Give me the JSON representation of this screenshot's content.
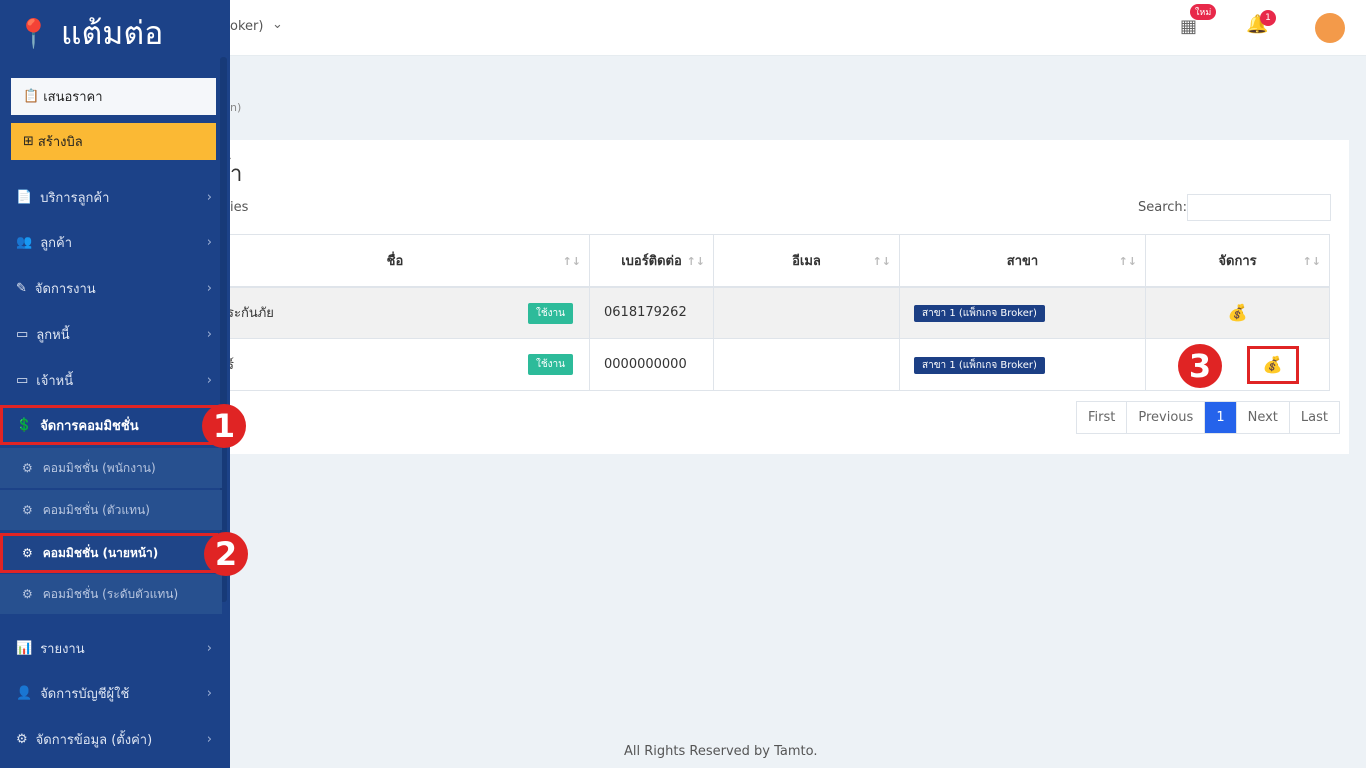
{
  "header": {
    "branch_fragment": "oker)",
    "badge_new": "ใหม่",
    "notif_count": "1"
  },
  "breadcrumb_fragment": "n)",
  "main": {
    "title_fragment": "้า",
    "show_entries_fragment": "ies",
    "info_fragment": "es",
    "search_label": "Search:",
    "search_value": "",
    "columns": [
      "ชื่อ",
      "เบอร์ติดต่อ",
      "อีเมล",
      "สาขา",
      "จัดการ"
    ],
    "rows": [
      {
        "name": "ระกันภัย",
        "status": "ใช้งาน",
        "phone": "0618179262",
        "email": "",
        "branch": "สาขา 1 (แพ็กเกจ Broker)"
      },
      {
        "name": "ร์",
        "status": "ใช้งาน",
        "phone": "0000000000",
        "email": "",
        "branch": "สาขา 1 (แพ็กเกจ Broker)"
      }
    ],
    "pagination": [
      "First",
      "Previous",
      "1",
      "Next",
      "Last"
    ]
  },
  "sidebar": {
    "logo": "แต้มต่อ",
    "quote": "เสนอราคา",
    "create_bill": "สร้างบิล",
    "items": [
      "บริการลูกค้า",
      "ลูกค้า",
      "จัดการงาน",
      "ลูกหนี้",
      "เจ้าหนี้",
      "จัดการคอมมิชชั่น"
    ],
    "subitems": [
      "คอมมิชชั่น (พนักงาน)",
      "คอมมิชชั่น (ตัวแทน)",
      "คอมมิชชั่น (นายหน้า)",
      "คอมมิชชั่น (ระดับตัวแทน)"
    ],
    "bottom": [
      "รายงาน",
      "จัดการบัญชีผู้ใช้",
      "จัดการข้อมูล (ตั้งค่า)"
    ]
  },
  "annotations": [
    "1",
    "2",
    "3"
  ],
  "footer": "All Rights Reserved by Tamto.",
  "colors": {
    "sidebar": "#1c4288",
    "accent": "#fbb934",
    "highlight": "#e02424",
    "active_page": "#2563eb"
  }
}
